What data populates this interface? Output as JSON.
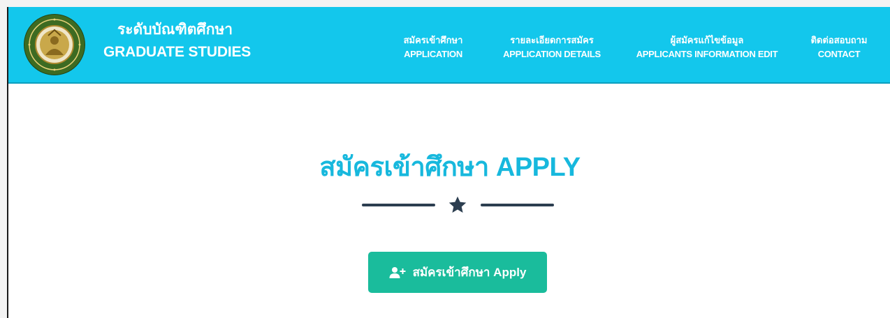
{
  "header": {
    "brand_th": "ระดับบัณฑิตศึกษา",
    "brand_en": "GRADUATE STUDIES",
    "logo_icon": "university-seal-icon",
    "nav": [
      {
        "th": "สมัครเข้าศึกษา",
        "en": "APPLICATION"
      },
      {
        "th": "รายละเอียดการสมัคร",
        "en": "APPLICATION DETAILS"
      },
      {
        "th": "ผู้สมัครแก้ไขข้อมูล",
        "en": "APPLICANTS INFORMATION EDIT"
      },
      {
        "th": "ติดต่อสอบถาม",
        "en": "CONTACT"
      }
    ]
  },
  "main": {
    "title": "สมัครเข้าศึกษา APPLY",
    "divider_icon": "star-icon",
    "apply_button": {
      "label": "สมัครเข้าศึกษา Apply",
      "icon": "user-plus-icon"
    }
  },
  "colors": {
    "navbar": "#13c7ec",
    "title": "#17b8dd",
    "button": "#1abc9c",
    "divider": "#2c3e50"
  }
}
